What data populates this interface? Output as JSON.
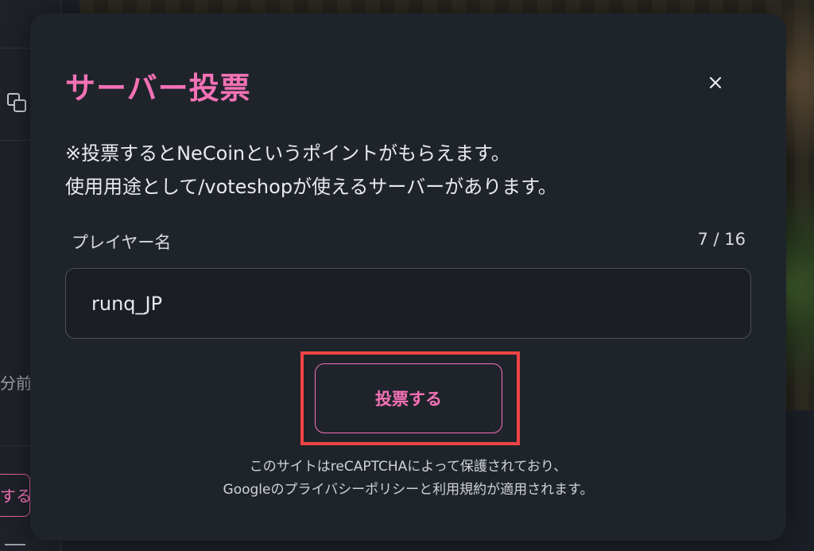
{
  "background": {
    "time_text": "分前",
    "vote_text": "する"
  },
  "modal": {
    "title": "サーバー投票",
    "close_symbol": "×",
    "note_line1": "※投票するとNeCoinというポイントがもらえます。",
    "note_line2": "使用用途として/voteshopが使えるサーバーがあります。",
    "field_label": "プレイヤー名",
    "char_count": "7 / 16",
    "player_name_value": "runq_JP",
    "vote_button_label": "投票する",
    "recaptcha_line1": "このサイトはreCAPTCHAによって保護されており、",
    "recaptcha_line2": "Googleのプライバシーポリシーと利用規約が適用されます。"
  },
  "colors": {
    "accent": "#f472b6",
    "highlight": "#ef4444",
    "modal_bg": "#1f242b"
  }
}
